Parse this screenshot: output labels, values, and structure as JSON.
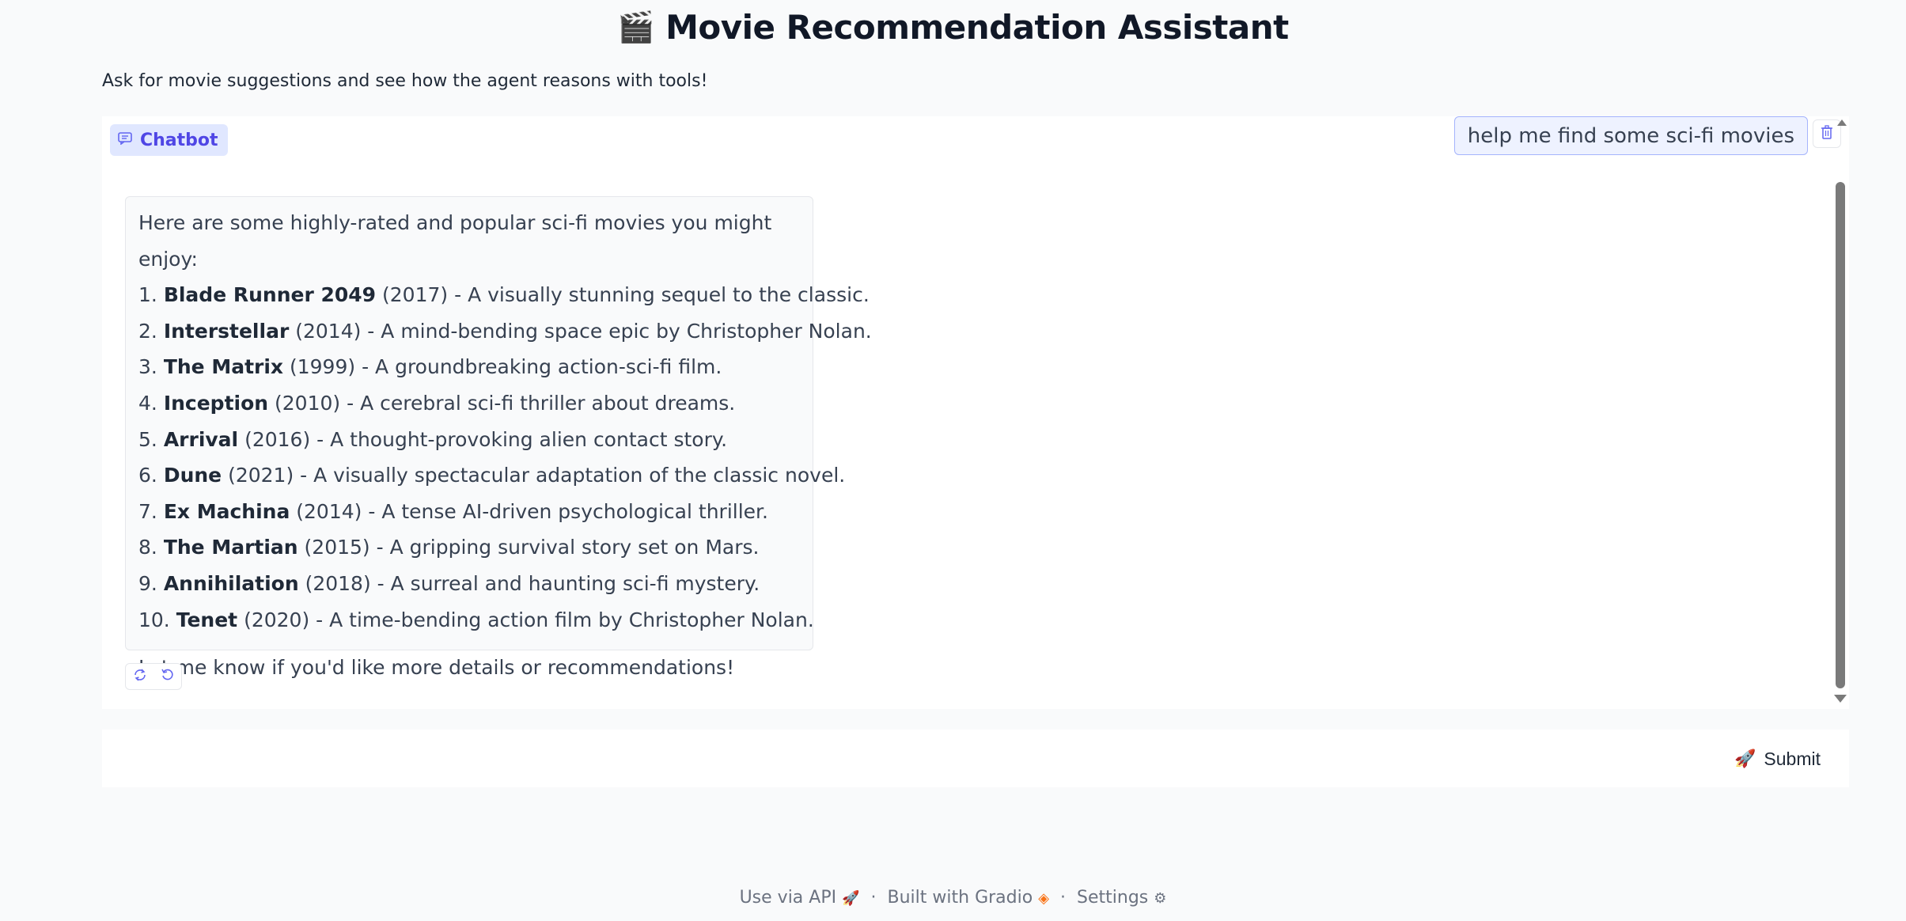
{
  "header": {
    "icon": "clapper-board-icon",
    "title": "Movie Recommendation Assistant",
    "subtitle": "Ask for movie suggestions and see how the agent reasons with tools!"
  },
  "chatbot": {
    "label": "Chatbot",
    "user_message": "help me find some sci-fi movies",
    "bot_intro": "Here are some highly-rated and popular sci-fi movies you might enjoy:",
    "recommendations": [
      {
        "num": "1.",
        "title": "Blade Runner 2049",
        "rest": " (2017) - A visually stunning sequel to the classic."
      },
      {
        "num": "2.",
        "title": "Interstellar",
        "rest": " (2014) - A mind-bending space epic by Christopher Nolan."
      },
      {
        "num": "3.",
        "title": "The Matrix",
        "rest": " (1999) - A groundbreaking action-sci-fi film."
      },
      {
        "num": "4.",
        "title": "Inception",
        "rest": " (2010) - A cerebral sci-fi thriller about dreams."
      },
      {
        "num": "5.",
        "title": "Arrival",
        "rest": " (2016) - A thought-provoking alien contact story."
      },
      {
        "num": "6.",
        "title": "Dune",
        "rest": " (2021) - A visually spectacular adaptation of the classic novel."
      },
      {
        "num": "7.",
        "title": "Ex Machina",
        "rest": " (2014) - A tense AI-driven psychological thriller."
      },
      {
        "num": "8.",
        "title": "The Martian",
        "rest": " (2015) - A gripping survival story set on Mars."
      },
      {
        "num": "9.",
        "title": "Annihilation",
        "rest": " (2018) - A surreal and haunting sci-fi mystery."
      },
      {
        "num": "10.",
        "title": "Tenet",
        "rest": " (2020) - A time-bending action film by Christopher Nolan."
      }
    ],
    "bot_outro": "Let me know if you'd like more details or recommendations!"
  },
  "input": {
    "placeholder": "",
    "value": "",
    "submit_label": "Submit"
  },
  "footer": {
    "api_label": "Use via API",
    "built_label": "Built with Gradio",
    "settings_label": "Settings",
    "separator": "·"
  },
  "colors": {
    "accent": "#6366f1",
    "background": "#f9fafb",
    "panel": "#ffffff"
  }
}
